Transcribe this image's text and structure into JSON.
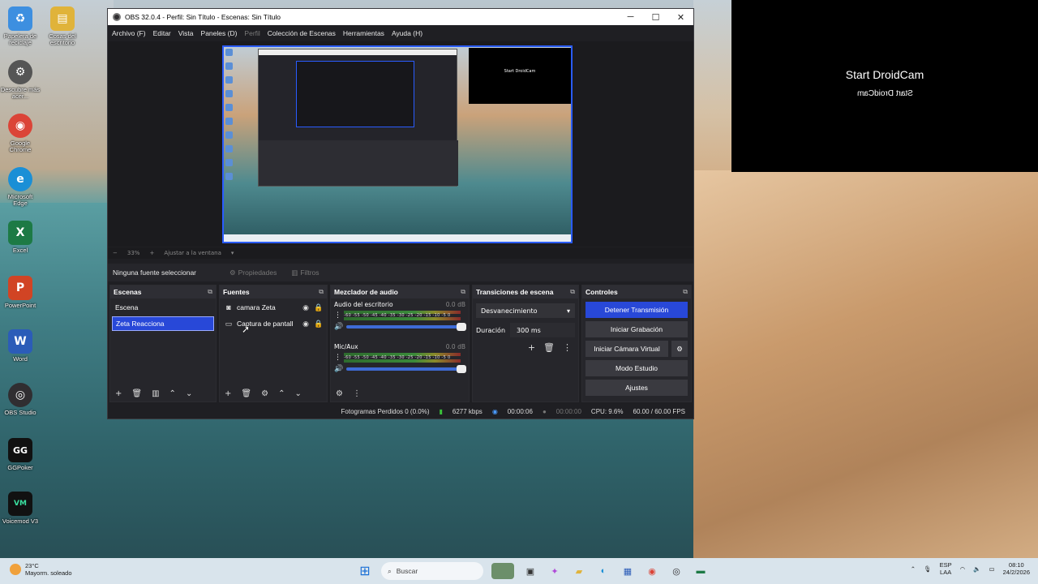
{
  "desktop": {
    "icons": [
      {
        "label": "Papelera de reciclaje",
        "glyph": "♻",
        "color": "#3d8fe0"
      },
      {
        "label": "Cosas del escritorio",
        "glyph": "▤",
        "color": "#e0b33a"
      },
      {
        "label": "Descubre más acer...",
        "glyph": "⚙",
        "color": "#555555"
      },
      {
        "label": "Google Chrome",
        "glyph": "◉",
        "color": "#db4437"
      },
      {
        "label": "Microsoft Edge",
        "glyph": "e",
        "color": "#1a8fd6"
      },
      {
        "label": "Excel",
        "glyph": "X",
        "color": "#1d7a45"
      },
      {
        "label": "PowerPoint",
        "glyph": "P",
        "color": "#d14424"
      },
      {
        "label": "Word",
        "glyph": "W",
        "color": "#2b5cb8"
      },
      {
        "label": "OBS Studio",
        "glyph": "◎",
        "color": "#302e31"
      },
      {
        "label": "GGPoker",
        "glyph": "GG",
        "color": "#111111"
      },
      {
        "label": "Voicemod V3",
        "glyph": "VM",
        "color": "#111111"
      }
    ],
    "droidcam_title": "Start DroidCam",
    "droidcam_mirror": "Start DroidCam"
  },
  "obs": {
    "window_title": "OBS 32.0.4 - Perfil: Sin Título - Escenas: Sin Título",
    "menu": [
      "Archivo (F)",
      "Editar",
      "Vista",
      "Paneles (D)",
      "Perfil",
      "Colección de Escenas",
      "Herramientas",
      "Ayuda (H)"
    ],
    "preview_nested_text": "Start DroidCam",
    "zoom": {
      "minus": "−",
      "percent": "33%",
      "plus": "+",
      "fit": "Ajustar a la ventana",
      "arrow": "▾"
    },
    "source_toolbar": {
      "no_selection": "Ninguna fuente seleccionar",
      "properties": "Propiedades",
      "filters": "Filtros"
    },
    "scenes": {
      "title": "Escenas",
      "items": [
        "Escena",
        "Zeta Reacciona"
      ],
      "selected_index": 1
    },
    "sources": {
      "title": "Fuentes",
      "items": [
        {
          "name": "camara Zeta",
          "icon": "camera-icon"
        },
        {
          "name": "Captura de pantall",
          "icon": "monitor-icon"
        }
      ]
    },
    "mixer": {
      "title": "Mezclador de audio",
      "ticks": "-60 -55 -50 -45 -40 -35 -30 -25 -20 -15 -10 -5 0",
      "channels": [
        {
          "name": "Audio del escritorio",
          "db": "0.0 dB"
        },
        {
          "name": "Mic/Aux",
          "db": "0.0 dB"
        }
      ]
    },
    "transitions": {
      "title": "Transiciones de escena",
      "selected": "Desvanecimiento",
      "duration_label": "Duración",
      "duration_value": "300 ms"
    },
    "controls": {
      "title": "Controles",
      "stop_stream": "Detener Transmisión",
      "start_recording": "Iniciar Grabación",
      "start_virtual_cam": "Iniciar Cámara Virtual",
      "studio_mode": "Modo Estudio",
      "settings": "Ajustes"
    },
    "status": {
      "dropped_frames": "Fotogramas Perdidos 0 (0.0%)",
      "bitrate": "6277 kbps",
      "stream_time": "00:00:06",
      "rec_time": "00:00:00",
      "cpu": "CPU: 9.6%",
      "fps": "60.00 / 60.00 FPS"
    }
  },
  "taskbar": {
    "weather_temp": "23°C",
    "weather_desc": "Mayorm. soleado",
    "search_placeholder": "Buscar",
    "lang_top": "ESP",
    "lang_bottom": "LAA",
    "time": "08:10",
    "date": "24/2/2026"
  },
  "colors": {
    "accent": "#2848d8",
    "obs_bg": "#1f1f23",
    "dock_bg": "#26262b"
  }
}
